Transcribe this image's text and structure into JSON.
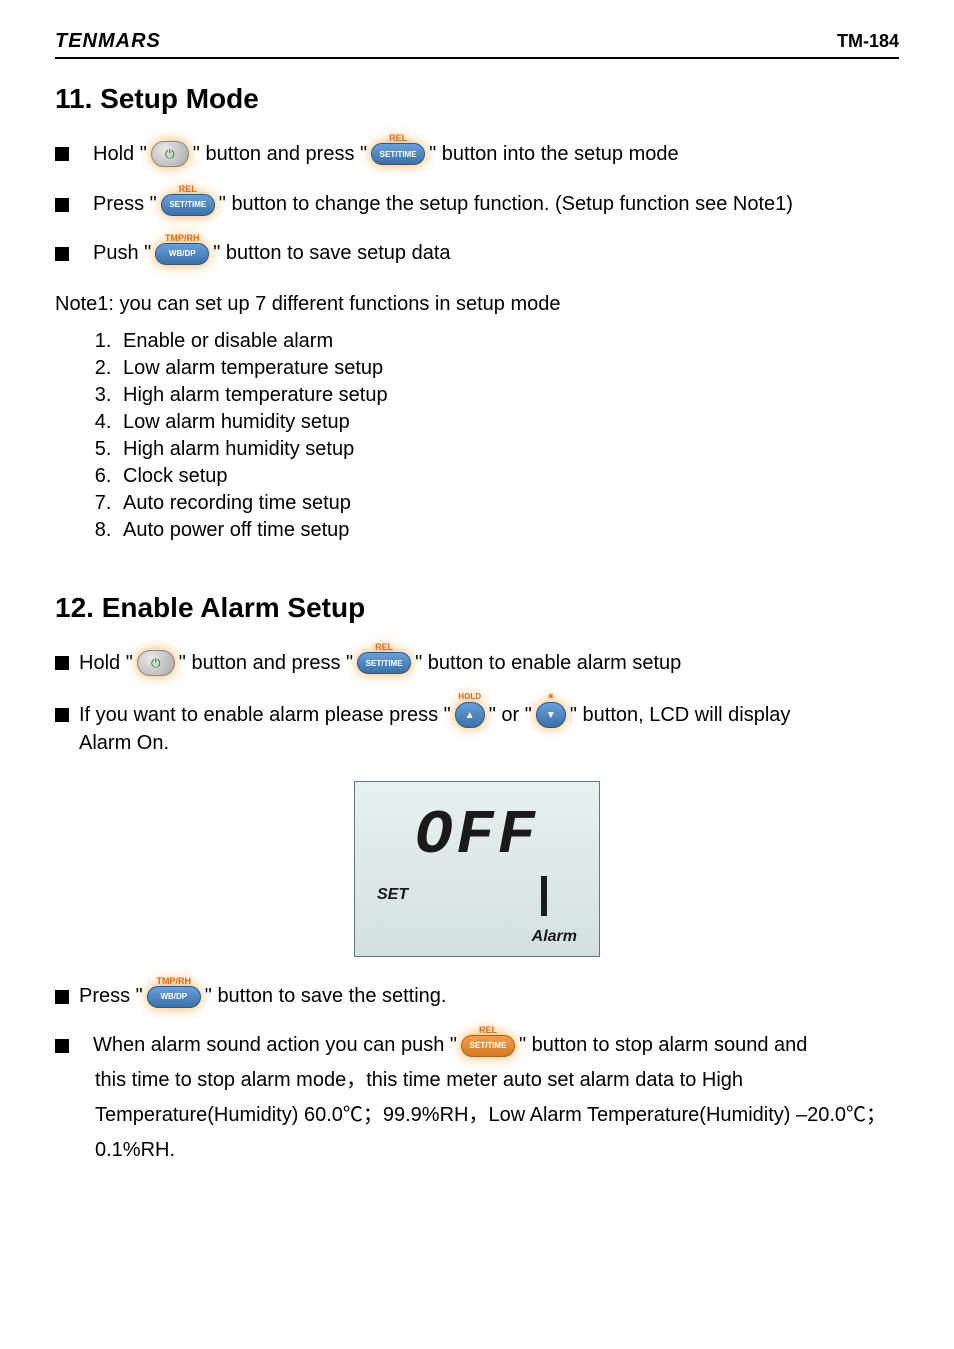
{
  "header": {
    "brand": "TENMARS",
    "model": "TM-184"
  },
  "section11": {
    "title": "11. Setup Mode",
    "b1a": "Hold \"",
    "b1b": "\" button and press \"",
    "b1c": "\" button into the setup mode",
    "b2a": "Press \"",
    "b2b": "\" button to change the setup function. (Setup function see Note1)",
    "b3a": "Push \"",
    "b3b": "\" button to save setup data",
    "note": "Note1: you can set up 7 different functions in setup mode",
    "items": [
      "Enable or disable alarm",
      "Low alarm temperature setup",
      "High alarm temperature setup",
      "Low alarm humidity setup",
      "High alarm humidity setup",
      "Clock setup",
      "Auto recording time setup",
      "Auto power off time setup"
    ]
  },
  "section12": {
    "title": "12. Enable Alarm Setup",
    "b1a": "Hold \"",
    "b1b": "\" button and press \"",
    "b1c": "\" button to enable alarm setup",
    "b2a": "If you want to enable alarm please press \"",
    "b2b": "\" or \"",
    "b2c": "\" button, LCD will display",
    "b2d": "Alarm On.",
    "lcd": {
      "main": "OFF",
      "set": "SET",
      "alarm": "Alarm"
    },
    "b3a": "Press \"",
    "b3b": "\" button to save the setting.",
    "b4a": "When alarm sound action you can push    \"",
    "b4b": "\" button to stop alarm sound and",
    "b4c": "this time to stop alarm mode，this time meter auto set alarm data to High Temperature(Humidity) 60.0℃；99.9%RH，Low Alarm Temperature(Humidity) –20.0℃；0.1%RH."
  },
  "icons": {
    "power": "power-icon",
    "rel_label": "REL",
    "set_time_label": "SET/TIME",
    "tmp_label": "TMP/RH",
    "wb_label": "WB/DP",
    "hold_label": "HOLD",
    "up": "▲",
    "down": "▼",
    "sun": "☀"
  }
}
